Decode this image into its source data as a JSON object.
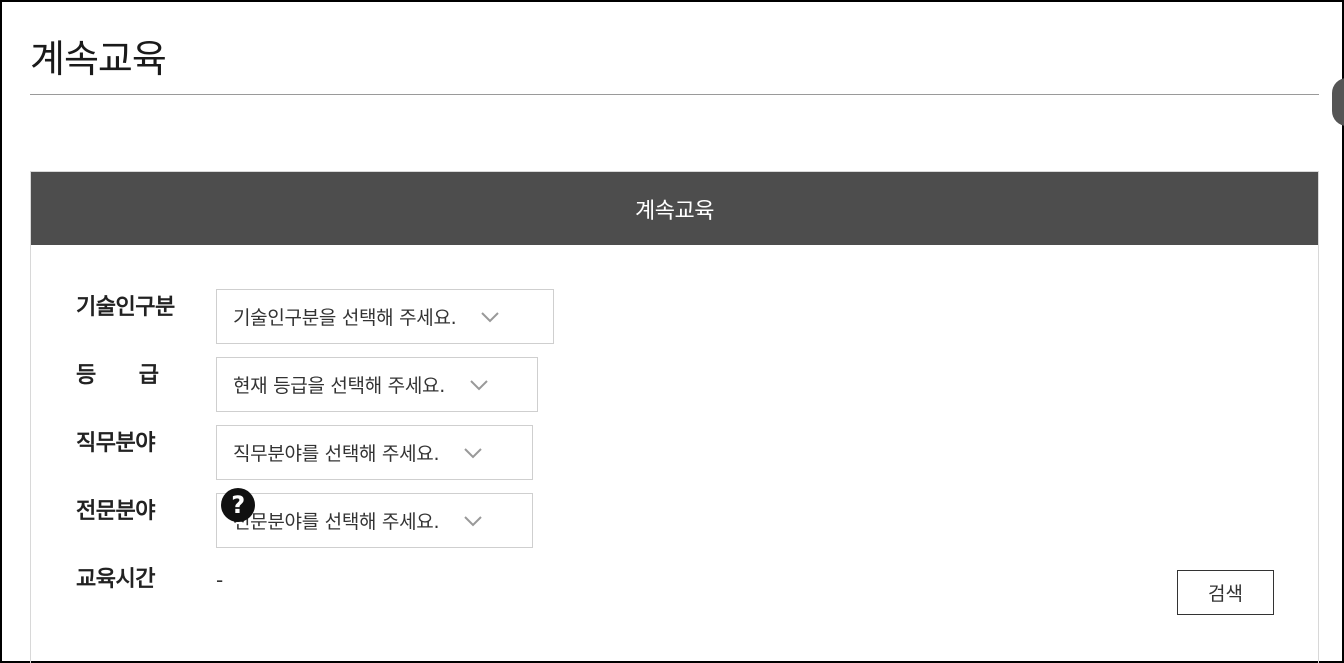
{
  "page": {
    "title": "계속교육"
  },
  "panel": {
    "header": "계속교육",
    "fields": {
      "tech_category": {
        "label": "기술인구분",
        "placeholder": "기술인구분을 선택해 주세요."
      },
      "grade": {
        "label": "등　　급",
        "placeholder": "현재 등급을 선택해 주세요."
      },
      "job_field": {
        "label": "직무분야",
        "placeholder": "직무분야를 선택해 주세요."
      },
      "specialty_field": {
        "label": "전문분야",
        "placeholder": "전문분야를 선택해 주세요.",
        "help": "?"
      },
      "training_hours": {
        "label": "교육시간",
        "value": "-"
      }
    },
    "search_label": "검색"
  }
}
